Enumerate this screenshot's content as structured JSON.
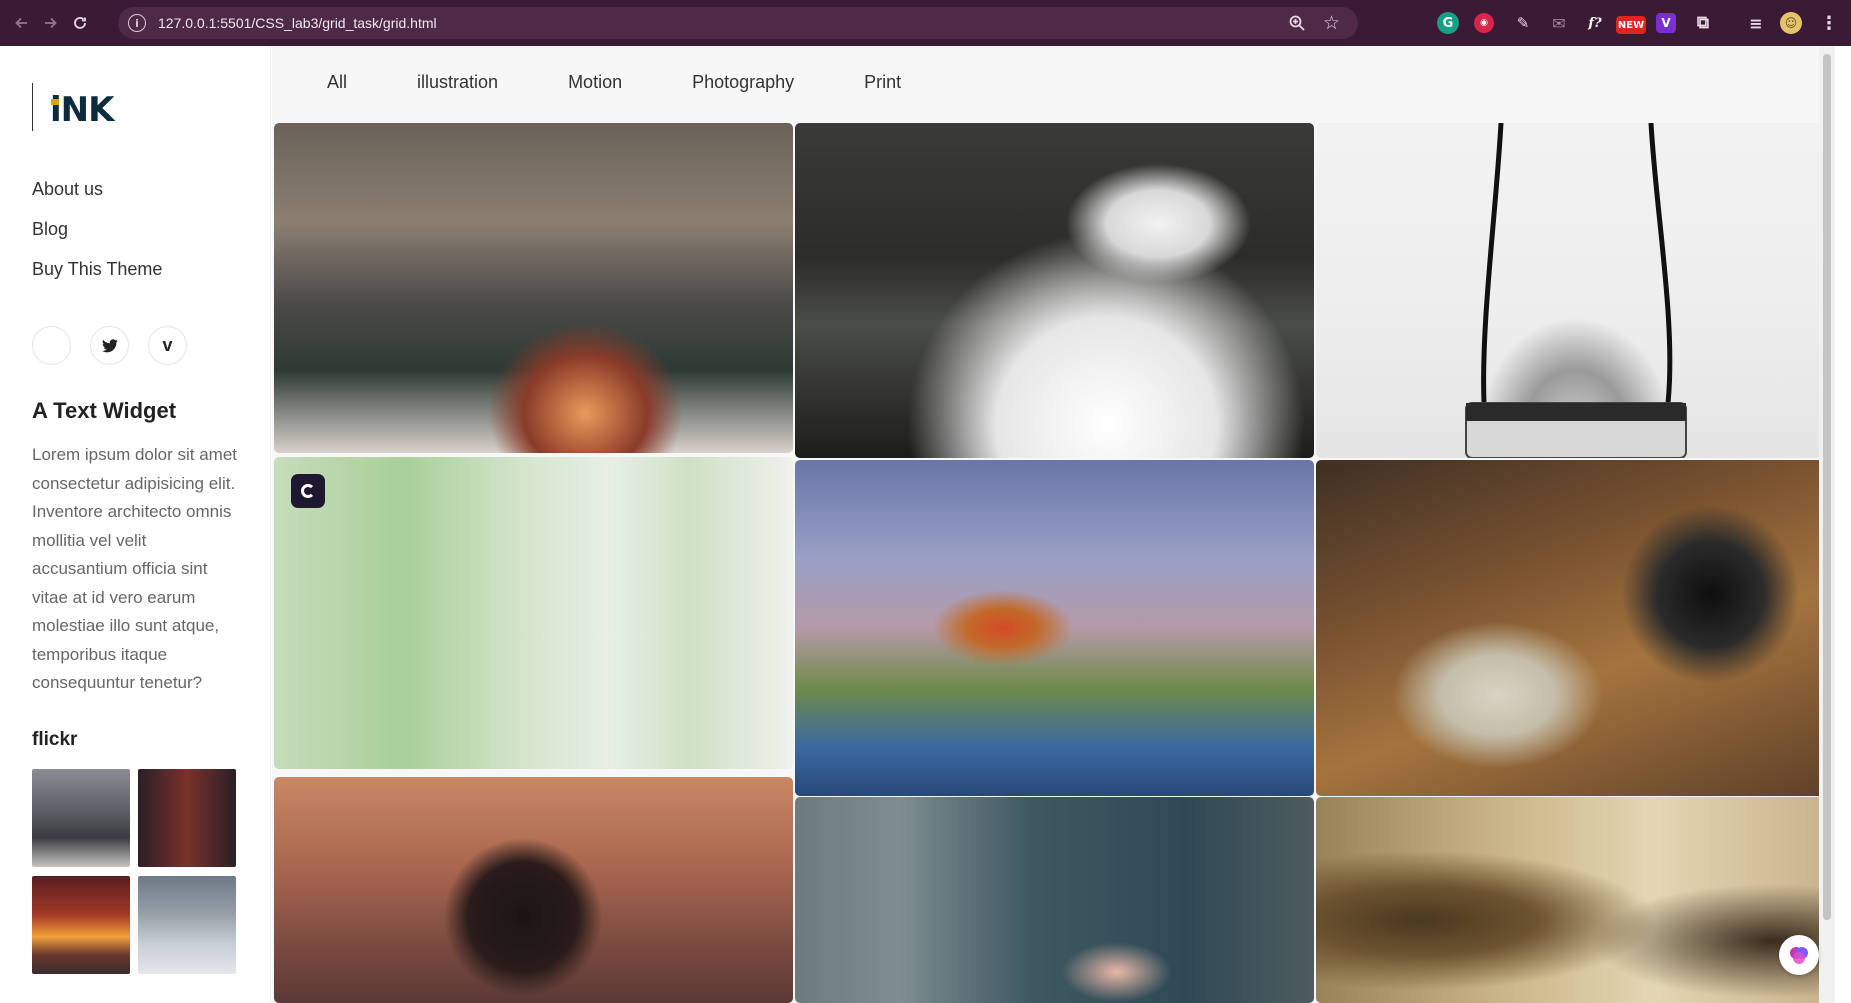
{
  "browser": {
    "url": "127.0.0.1:5501/CSS_lab3/grid_task/grid.html",
    "extension_badge": "NEW"
  },
  "sidebar": {
    "logo": "iNK",
    "nav": [
      {
        "label": "About us"
      },
      {
        "label": "Blog"
      },
      {
        "label": "Buy This Theme"
      }
    ],
    "social": [
      "blank-social-icon",
      "twitter-icon",
      "vimeo-icon"
    ],
    "text_widget": {
      "title": "A Text Widget",
      "body": "Lorem ipsum dolor sit amet consectetur adipisicing elit. Inventore architecto omnis mollitia vel velit accusantium officia sint vitae at id vero earum molestiae illo sunt atque, temporibus itaque consequuntur tenetur?"
    },
    "flickr": {
      "title": "flickr",
      "photos": [
        "city-street-photo",
        "red-road-photo",
        "sunset-street-photo",
        "snowy-street-photo"
      ]
    }
  },
  "main": {
    "filters": [
      {
        "label": "All"
      },
      {
        "label": "illustration"
      },
      {
        "label": "Motion"
      },
      {
        "label": "Photography"
      },
      {
        "label": "Print"
      }
    ],
    "gallery": [
      {
        "name": "family-birthday-photo"
      },
      {
        "name": "photographer-in-snow-photo"
      },
      {
        "name": "hanging-canon-camera-photo"
      },
      {
        "name": "blurred-green-window-photo"
      },
      {
        "name": "eagle-hunters-on-horses-photo"
      },
      {
        "name": "vintage-camera-with-polaroids-photo"
      },
      {
        "name": "photographer-closeup-photo"
      },
      {
        "name": "studio-photoshoot-photo"
      },
      {
        "name": "sepia-vintage-portrait-photo"
      }
    ]
  }
}
